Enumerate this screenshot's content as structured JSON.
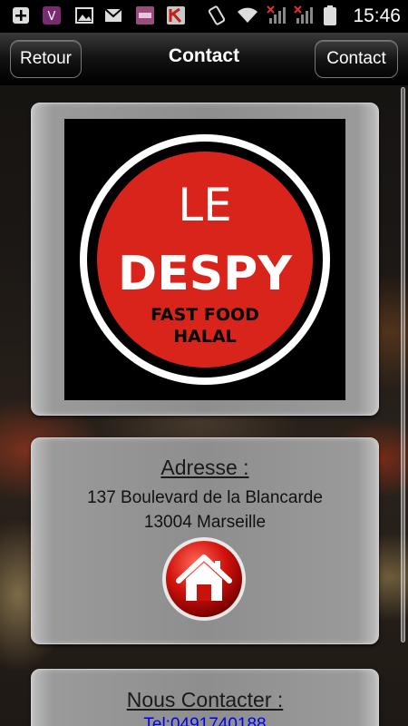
{
  "status_bar": {
    "time": "15:46",
    "icons": [
      "add-icon",
      "app-icon",
      "image-icon",
      "mail-icon",
      "app-icon",
      "app-icon",
      "phone-rotate-icon",
      "wifi-icon",
      "signal-icon",
      "signal-icon",
      "battery-icon"
    ]
  },
  "navbar": {
    "back_label": "Retour",
    "title": "Contact",
    "right_label": "Contact"
  },
  "logo": {
    "line1": "LE",
    "line2": "DESPY",
    "line3": "FAST FOOD",
    "line4": "HALAL",
    "colors": {
      "circle": "#d9241c",
      "ring": "#ffffff",
      "background": "#000000"
    }
  },
  "address_card": {
    "title": "Adresse :",
    "line1": "137 Boulevard de la Blancarde",
    "line2": "13004 Marseille",
    "button_icon": "home-icon"
  },
  "contact_card": {
    "title": "Nous Contacter :",
    "phone": "Tel:0491740188"
  }
}
